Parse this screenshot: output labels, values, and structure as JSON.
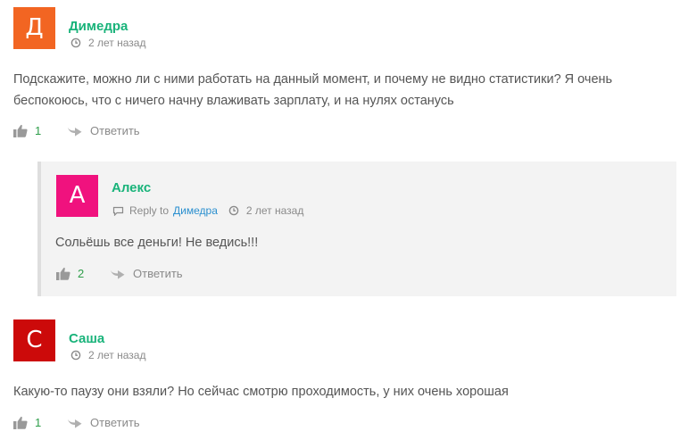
{
  "comments": [
    {
      "avatar_letter": "Д",
      "avatar_color": "#f26522",
      "author": "Димедра",
      "time": "2 лет назад",
      "text": "Подскажите, можно ли с ними работать на данный момент, и почему не видно статистики? Я очень беспокоюсь, что с ничего начну влаживать зарплату, и на нулях останусь",
      "likes": "1",
      "reply_label": "Ответить"
    },
    {
      "avatar_letter": "С",
      "avatar_color": "#cc0a0a",
      "author": "Саша",
      "time": "2 лет назад",
      "text": "Какую-то паузу они взяли? Но сейчас смотрю проходимость, у них очень хорошая",
      "likes": "1",
      "reply_label": "Ответить"
    }
  ],
  "reply": {
    "avatar_letter": "А",
    "avatar_color": "#f0127e",
    "author": "Алекс",
    "reply_to_label": "Reply to",
    "reply_to_name": "Димедра",
    "time": "2 лет назад",
    "text": "Сольёшь все деньги! Не ведись!!!",
    "likes": "2",
    "reply_label": "Ответить"
  },
  "colors": {
    "author": "#19b37a",
    "link": "#2a8fcf",
    "likes": "#2e9e4a",
    "muted": "#8a8a8a",
    "reply_bg": "#f3f3f3"
  },
  "icons": {
    "clock": "clock-icon",
    "like": "thumbs-up-icon",
    "reply": "reply-arrow-icon"
  }
}
